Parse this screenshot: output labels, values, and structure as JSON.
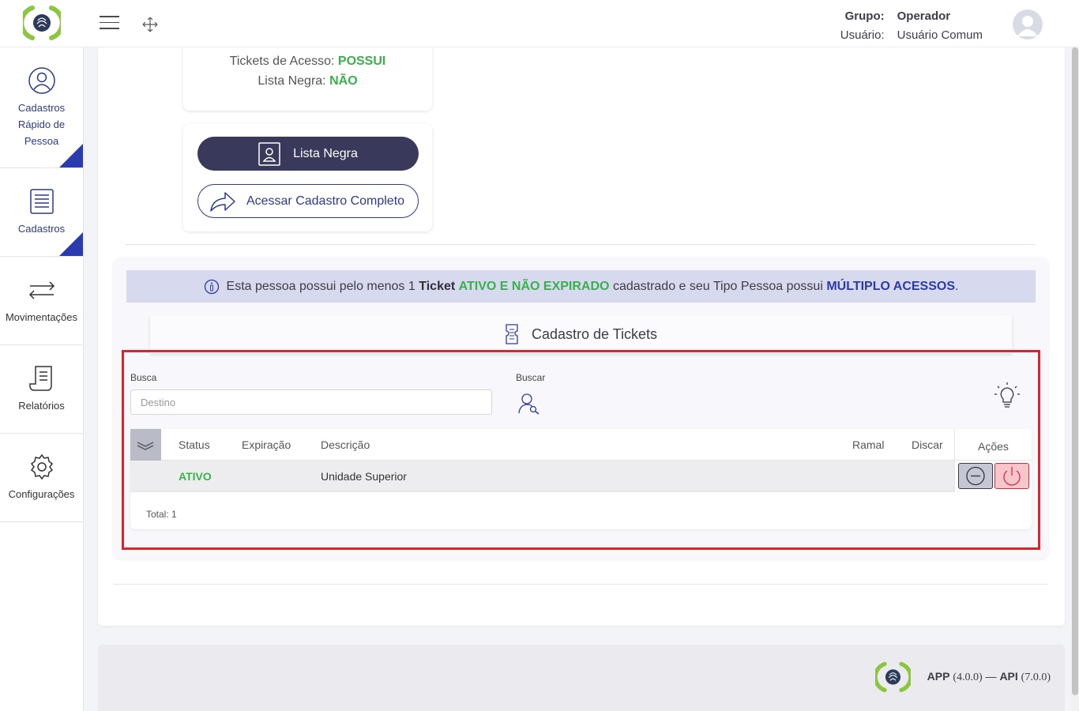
{
  "header": {
    "group_label": "Grupo:",
    "group_value": "Operador",
    "user_label": "Usuário:",
    "user_value": "Usuário Comum"
  },
  "sidebar": {
    "items": [
      {
        "label": "Cadastros Rápido de Pessoa",
        "icon": "person-circle-icon"
      },
      {
        "label": "Cadastros",
        "icon": "list-document-icon"
      },
      {
        "label": "Movimentações",
        "icon": "arrows-exchange-icon"
      },
      {
        "label": "Relatórios",
        "icon": "report-scroll-icon"
      },
      {
        "label": "Configurações",
        "icon": "gear-icon"
      }
    ]
  },
  "info": {
    "tickets_label": "Tickets de Acesso:",
    "tickets_value": "POSSUI",
    "blacklist_label": "Lista Negra:",
    "blacklist_value": "NÃO"
  },
  "buttons": {
    "blacklist": "Lista Negra",
    "full_record": "Acessar Cadastro Completo"
  },
  "alert": {
    "part1": "Esta pessoa possui pelo menos 1",
    "ticket": "Ticket",
    "status": "ATIVO E NÃO EXPIRADO",
    "part2": "cadastrado e seu Tipo Pessoa possui",
    "access": "MÚLTIPLO ACESSOS",
    "end": "."
  },
  "tab": {
    "title": "Cadastro de Tickets"
  },
  "search": {
    "label": "Busca",
    "placeholder": "Destino",
    "button_label": "Buscar"
  },
  "table": {
    "columns": {
      "status": "Status",
      "expiration": "Expiração",
      "description": "Descrição",
      "extension": "Ramal",
      "dial": "Discar",
      "actions": "Ações"
    },
    "rows": [
      {
        "status": "ATIVO",
        "expiration": "",
        "description": "Unidade Superior",
        "extension": "",
        "dial": ""
      }
    ],
    "total": "Total: 1"
  },
  "footer": {
    "app_label": "APP",
    "app_version": "(4.0.0)",
    "sep": "—",
    "api_label": "API",
    "api_version": "(7.0.0)"
  },
  "colors": {
    "brand_green": "#8cc63f",
    "navy": "#2c3a8a",
    "dark_button": "#38395b",
    "status_green": "#39b14a",
    "highlight_red": "#d8262f"
  }
}
